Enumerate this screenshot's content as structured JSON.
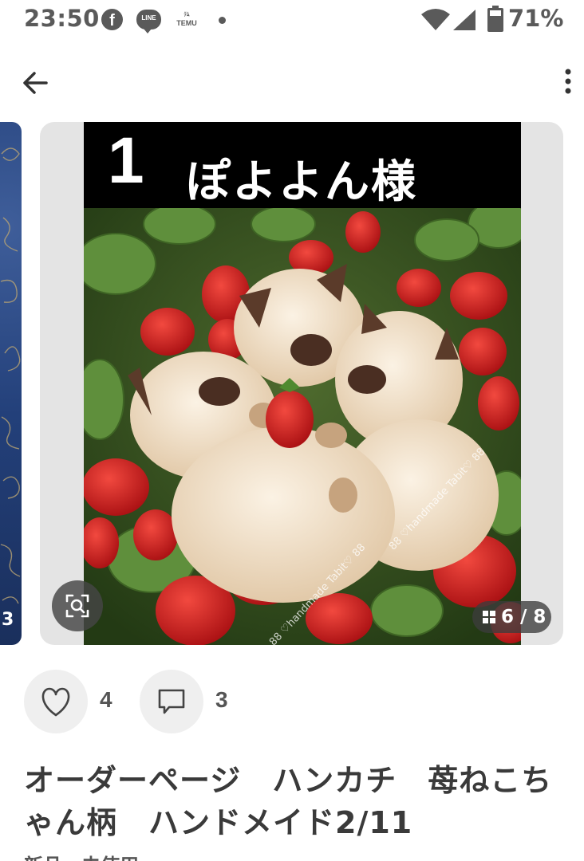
{
  "status_bar": {
    "time": "23:50",
    "temu_label": "TEMU",
    "line_label": "LINE",
    "battery": "71%"
  },
  "icons": {
    "back": "arrow-left",
    "more": "more-vertical",
    "like": "heart-outline",
    "comment": "speech-bubble-outline",
    "visual_search": "scan-search",
    "gallery": "grid"
  },
  "carousel": {
    "left_peek_text": "3",
    "banner_number": "1",
    "banner_name": "ぽよよん様",
    "watermark": "88 ♡handmade Tabit♡ 88",
    "page_indicator": "6 / 8"
  },
  "actions": {
    "like_count": "4",
    "comment_count": "3"
  },
  "item": {
    "title": "オーダーページ　ハンカチ　苺ねこちゃん柄　ハンドメイド2/11",
    "condition": "新品、未使用"
  },
  "colors": {
    "background": "#ffffff",
    "icon_gray": "#5a5a5a",
    "button_bg": "#efefef",
    "text": "#3a3a3a"
  }
}
